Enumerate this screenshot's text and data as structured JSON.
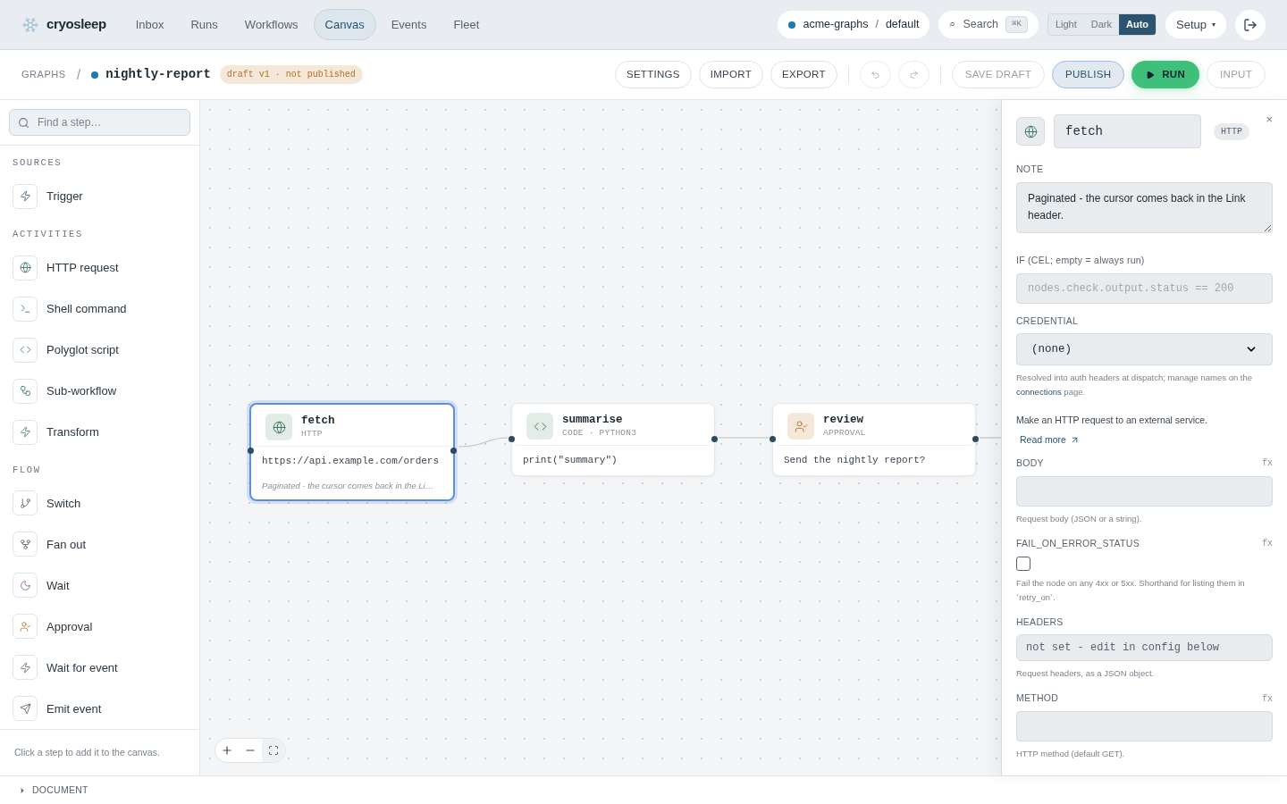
{
  "app": {
    "name": "cryosleep"
  },
  "nav": [
    {
      "label": "Inbox",
      "selected": false
    },
    {
      "label": "Runs",
      "selected": false
    },
    {
      "label": "Workflows",
      "selected": false
    },
    {
      "label": "Canvas",
      "selected": true
    },
    {
      "label": "Events",
      "selected": false
    },
    {
      "label": "Fleet",
      "selected": false
    }
  ],
  "workspace": {
    "org": "acme-graphs",
    "separator": "/",
    "env": "default"
  },
  "search": {
    "glyph": "⌕",
    "label": "Search",
    "shortcut": "⌘K"
  },
  "theme": [
    {
      "label": "Light",
      "selected": false
    },
    {
      "label": "Dark",
      "selected": false
    },
    {
      "label": "Auto",
      "selected": true
    }
  ],
  "setup": {
    "label": "Setup",
    "caret": "▾"
  },
  "breadcrumb": {
    "root": "GRAPHS",
    "separator": "/",
    "graph": "nightly-report",
    "status": "draft v1 · not published"
  },
  "toolbar": [
    {
      "label": "SETTINGS",
      "kind": "plain"
    },
    {
      "label": "IMPORT",
      "kind": "plain"
    },
    {
      "label": "EXPORT",
      "kind": "plain"
    },
    {
      "kind": "divider"
    },
    {
      "kind": "undo"
    },
    {
      "kind": "redo"
    },
    {
      "kind": "divider"
    },
    {
      "label": "SAVE DRAFT",
      "kind": "muted"
    },
    {
      "label": "PUBLISH",
      "kind": "primary"
    },
    {
      "label": "RUN",
      "kind": "run"
    },
    {
      "label": "INPUT",
      "kind": "muted"
    }
  ],
  "sidebar": {
    "search_placeholder": "Find a step…",
    "sections": [
      {
        "title": "SOURCES",
        "items": [
          {
            "label": "Trigger",
            "kind": "trigger"
          }
        ]
      },
      {
        "title": "ACTIVITIES",
        "items": [
          {
            "label": "HTTP request",
            "kind": "http"
          },
          {
            "label": "Shell command",
            "kind": "shell"
          },
          {
            "label": "Polyglot script",
            "kind": "code"
          },
          {
            "label": "Sub-workflow",
            "kind": "subflow"
          },
          {
            "label": "Transform",
            "kind": "transform"
          }
        ]
      },
      {
        "title": "FLOW",
        "items": [
          {
            "label": "Switch",
            "kind": "switch"
          },
          {
            "label": "Fan out",
            "kind": "fanout"
          },
          {
            "label": "Wait",
            "kind": "wait"
          },
          {
            "label": "Approval",
            "kind": "approval"
          },
          {
            "label": "Wait for event",
            "kind": "waitevent"
          },
          {
            "label": "Emit event",
            "kind": "emit"
          }
        ]
      }
    ],
    "hint": "Click a step to add it to the canvas."
  },
  "nodes": [
    {
      "name": "fetch",
      "type": "HTTP",
      "kind": "http",
      "body": "https://api.example.com/orders",
      "note": "Paginated - the cursor comes back in the Li…",
      "selected": true
    },
    {
      "name": "summarise",
      "type": "CODE · PYTHON3",
      "kind": "code",
      "body": "print(\"summary\")",
      "selected": false
    },
    {
      "name": "review",
      "type": "APPROVAL",
      "kind": "approval",
      "body": "Send the nightly report?",
      "selected": false
    }
  ],
  "inspector": {
    "kind": "http",
    "name": "fetch",
    "badge": "HTTP",
    "close": "×",
    "fields": [
      {
        "kind": "textarea",
        "label": "NOTE",
        "value": "Paginated - the cursor comes back in the Link header."
      },
      {
        "kind": "input",
        "label": "IF (CEL; empty = always run)",
        "placeholder": "nodes.check.output.status == 200",
        "mono": true
      },
      {
        "kind": "select",
        "label": "CREDENTIAL",
        "value": "(none)",
        "help_parts": [
          "Resolved into auth headers at dispatch; manage names on the ",
          "connections",
          " page."
        ]
      },
      {
        "kind": "about",
        "text": "Make an HTTP request to an external service.",
        "link": "Read more"
      },
      {
        "kind": "input",
        "label": "BODY",
        "fx": "fx",
        "help": "Request body (JSON or a string)."
      },
      {
        "kind": "checkbox",
        "label": "FAIL_ON_ERROR_STATUS",
        "fx": "fx",
        "checked": false,
        "help": "Fail the node on any 4xx or 5xx. Shorthand for listing them in `retry_on`."
      },
      {
        "kind": "readonly",
        "label": "HEADERS",
        "value": "not set - edit in config below",
        "help": "Request headers, as a JSON object."
      },
      {
        "kind": "input",
        "label": "METHOD",
        "fx": "fx",
        "help": "HTTP method (default GET)."
      }
    ]
  },
  "document": {
    "label": "DOCUMENT",
    "expanded": false
  }
}
